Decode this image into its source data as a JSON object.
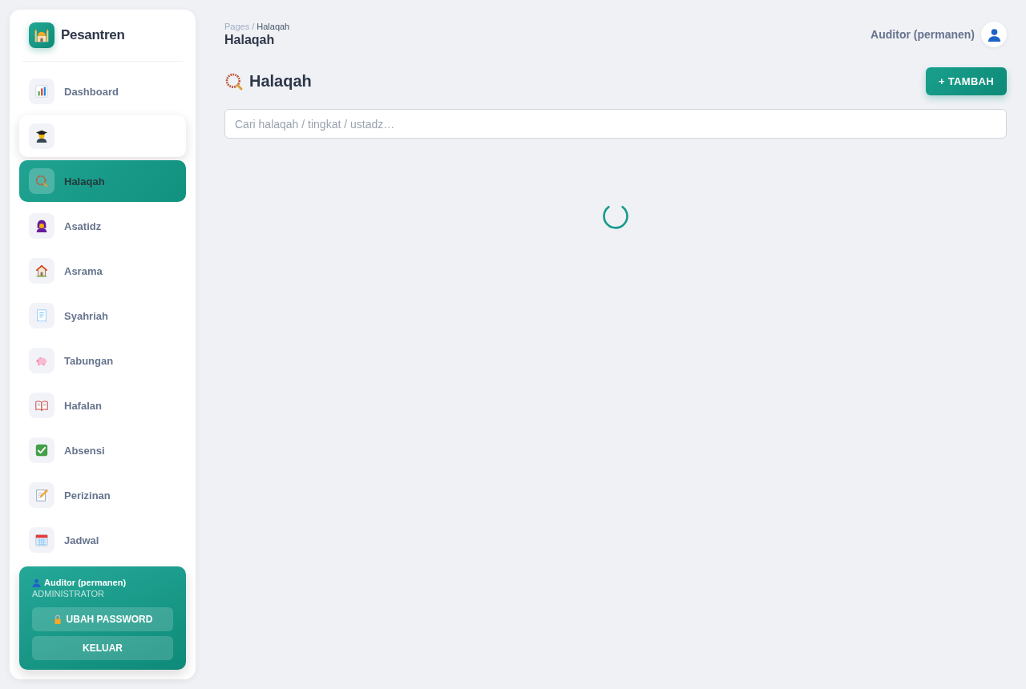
{
  "sidebar": {
    "brand": "Pesantren",
    "items": [
      {
        "label": "Dashboard",
        "selected": false,
        "hovered": false
      },
      {
        "selected": false,
        "hovered": true
      },
      {
        "label": "Halaqah",
        "selected": true,
        "hovered": false
      },
      {
        "label": "Asatidz",
        "selected": false,
        "hovered": false
      },
      {
        "label": "Asrama",
        "selected": false,
        "hovered": false
      },
      {
        "label": "Syahriah",
        "selected": false,
        "hovered": false
      },
      {
        "label": "Tabungan",
        "selected": false,
        "hovered": false
      },
      {
        "label": "Hafalan",
        "selected": false,
        "hovered": false
      },
      {
        "label": "Absensi",
        "selected": false,
        "hovered": false
      },
      {
        "label": "Perizinan",
        "selected": false,
        "hovered": false
      },
      {
        "label": "Jadwal",
        "selected": false,
        "hovered": false
      }
    ],
    "user_card": {
      "name": "Auditor (permanen)",
      "role": "ADMINISTRATOR",
      "buttons": [
        {
          "label": "UBAH PASSWORD",
          "kind": "password"
        },
        {
          "label": "KELUAR",
          "kind": "logout"
        }
      ]
    }
  },
  "header": {
    "breadcrumb": {
      "items": [
        "Pages",
        "Halaqah"
      ],
      "separator": "/"
    },
    "title": "Halaqah",
    "user_name": "Auditor (permanen)"
  },
  "content": {
    "heading": "Halaqah",
    "add_button": "+ TAMBAH",
    "search": {
      "placeholder": "Cari halaqah / tingkat / ustadz…"
    },
    "loading": true
  }
}
